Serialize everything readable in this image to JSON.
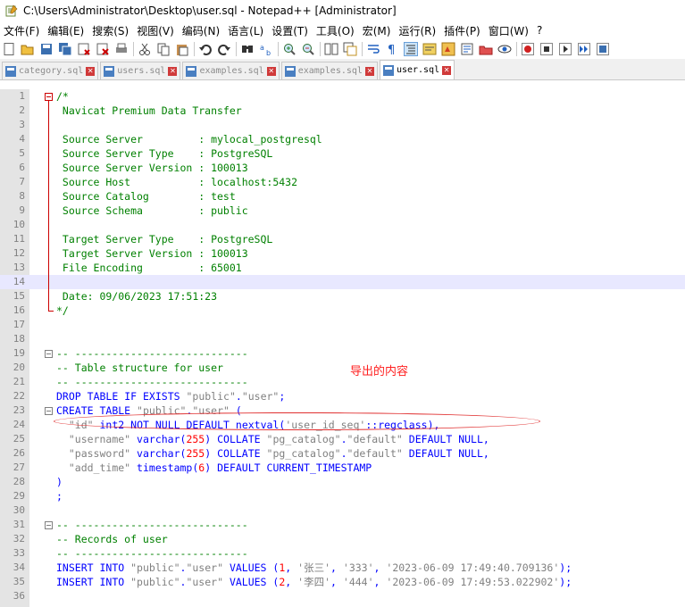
{
  "window": {
    "title": "C:\\Users\\Administrator\\Desktop\\user.sql - Notepad++ [Administrator]"
  },
  "menu": [
    "文件(F)",
    "编辑(E)",
    "搜索(S)",
    "视图(V)",
    "编码(N)",
    "语言(L)",
    "设置(T)",
    "工具(O)",
    "宏(M)",
    "运行(R)",
    "插件(P)",
    "窗口(W)",
    "?"
  ],
  "tabs": [
    {
      "label": "category.sql",
      "active": false
    },
    {
      "label": "users.sql",
      "active": false
    },
    {
      "label": "examples.sql",
      "active": false
    },
    {
      "label": "examples.sql",
      "active": false
    },
    {
      "label": "user.sql",
      "active": true
    }
  ],
  "editor": {
    "annotation": "导出的内容",
    "lines": [
      {
        "n": "1",
        "text": "/*"
      },
      {
        "n": "2",
        "text": " Navicat Premium Data Transfer"
      },
      {
        "n": "3",
        "text": ""
      },
      {
        "n": "4",
        "text": " Source Server         : mylocal_postgresql"
      },
      {
        "n": "5",
        "text": " Source Server Type    : PostgreSQL"
      },
      {
        "n": "6",
        "text": " Source Server Version : 100013"
      },
      {
        "n": "7",
        "text": " Source Host           : localhost:5432"
      },
      {
        "n": "8",
        "text": " Source Catalog        : test"
      },
      {
        "n": "9",
        "text": " Source Schema         : public"
      },
      {
        "n": "10",
        "text": ""
      },
      {
        "n": "11",
        "text": " Target Server Type    : PostgreSQL"
      },
      {
        "n": "12",
        "text": " Target Server Version : 100013"
      },
      {
        "n": "13",
        "text": " File Encoding         : 65001"
      },
      {
        "n": "14",
        "text": ""
      },
      {
        "n": "15",
        "text": " Date: 09/06/2023 17:51:23"
      },
      {
        "n": "16",
        "text": "*/"
      },
      {
        "n": "17",
        "text": ""
      },
      {
        "n": "18",
        "text": ""
      },
      {
        "n": "19",
        "text": "-- ----------------------------"
      },
      {
        "n": "20",
        "text": "-- Table structure for user"
      },
      {
        "n": "21",
        "text": "-- ----------------------------"
      },
      {
        "n": "22",
        "text": "DROP TABLE IF EXISTS \"public\".\"user\";"
      },
      {
        "n": "23",
        "text": "CREATE TABLE \"public\".\"user\" ("
      },
      {
        "n": "24",
        "text": "  \"id\" int2 NOT NULL DEFAULT nextval('user_id_seq'::regclass),"
      },
      {
        "n": "25",
        "text": "  \"username\" varchar(255) COLLATE \"pg_catalog\".\"default\" DEFAULT NULL,"
      },
      {
        "n": "26",
        "text": "  \"password\" varchar(255) COLLATE \"pg_catalog\".\"default\" DEFAULT NULL,"
      },
      {
        "n": "27",
        "text": "  \"add_time\" timestamp(6) DEFAULT CURRENT_TIMESTAMP"
      },
      {
        "n": "28",
        "text": ")"
      },
      {
        "n": "29",
        "text": ";"
      },
      {
        "n": "30",
        "text": ""
      },
      {
        "n": "31",
        "text": "-- ----------------------------"
      },
      {
        "n": "32",
        "text": "-- Records of user"
      },
      {
        "n": "33",
        "text": "-- ----------------------------"
      },
      {
        "n": "34",
        "text": "INSERT INTO \"public\".\"user\" VALUES (1, '张三', '333', '2023-06-09 17:49:40.709136');"
      },
      {
        "n": "35",
        "text": "INSERT INTO \"public\".\"user\" VALUES (2, '李四', '444', '2023-06-09 17:49:53.022902');"
      },
      {
        "n": "36",
        "text": ""
      }
    ]
  }
}
